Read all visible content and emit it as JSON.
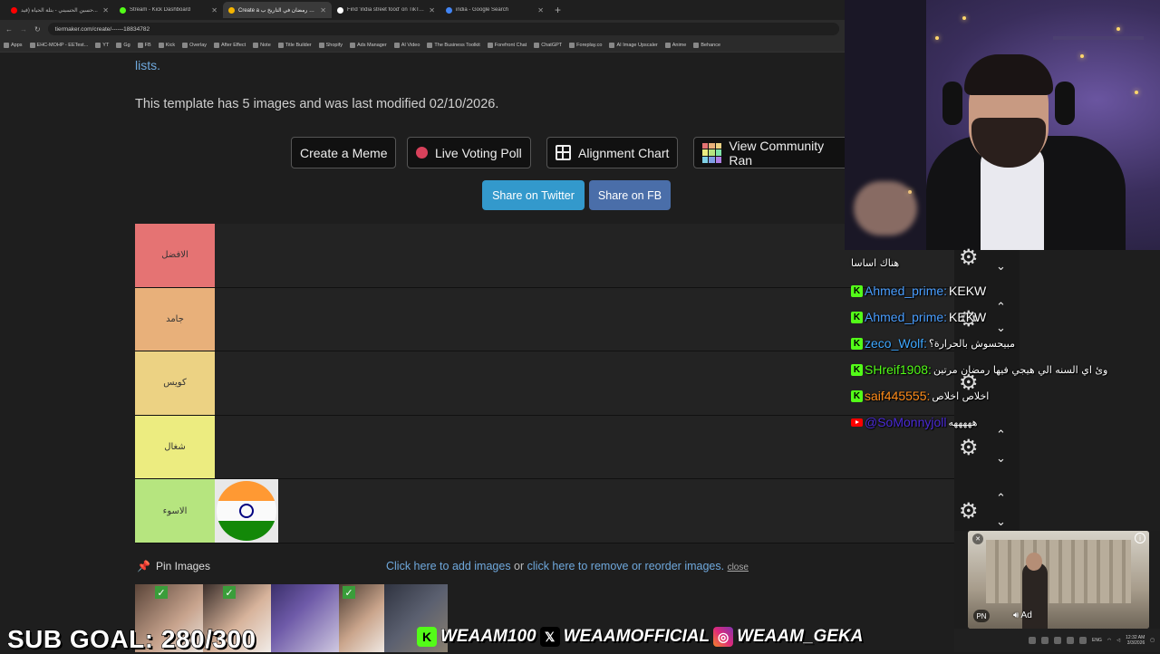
{
  "browser": {
    "tabs": [
      {
        "title": "حسين الحسيني - بتلة الحياة (فيد...",
        "color": "#ff0000",
        "active": false
      },
      {
        "title": "Stream - Kick Dashboard",
        "color": "#53fc18",
        "active": false
      },
      {
        "title": "Create a ماتات رمضان في التاريخ ب...",
        "color": "#f4b400",
        "active": true
      },
      {
        "title": "Find 'india street food' on TikTok...",
        "color": "#ffffff",
        "active": false
      },
      {
        "title": "india - Google Search",
        "color": "#4285f4",
        "active": false
      }
    ],
    "url": "tiermaker.com/create/------18834782",
    "bookmarks": [
      "Apps",
      "EHC-MOHP - EETest...",
      "YT",
      "Gg",
      "FB",
      "Kick",
      "Overlay",
      "After Effect",
      "Note",
      "Title Builder",
      "Shopify",
      "Ads Manager",
      "AI Video",
      "The Business Toolkit",
      "Forefront Chat",
      "ChatGPT",
      "Foreplay.co",
      "AI Image Upscaler",
      "Anime",
      "Behance"
    ]
  },
  "page": {
    "lists_link": "lists.",
    "info_text": "This template has 5 images and was last modified 02/10/2026.",
    "buttons": {
      "create_meme": "Create a Meme",
      "live_poll": "Live Voting Poll",
      "alignment_chart": "Alignment Chart",
      "community_rank": "View Community Ran"
    },
    "share": {
      "twitter": "Share on Twitter",
      "fb": "Share on FB"
    },
    "tiers": [
      {
        "label": "الافضل",
        "color": "#e57373"
      },
      {
        "label": "جامد",
        "color": "#e8b07a"
      },
      {
        "label": "كويس",
        "color": "#ecd283"
      },
      {
        "label": "شغال",
        "color": "#ecec80"
      },
      {
        "label": "الاسوء",
        "color": "#b6e57f"
      }
    ],
    "pin_images": "Pin Images",
    "add_images": "Click here to add images",
    "or": " or ",
    "remove_images": "click here to remove or reorder images.",
    "close": "close"
  },
  "chat": [
    {
      "platform": "none",
      "user": "",
      "user_color": "#ffffff",
      "message": "هناك اساسا"
    },
    {
      "platform": "kick",
      "user": "Ahmed_prime:",
      "user_color": "#4a9eff",
      "message": "KEKW"
    },
    {
      "platform": "kick",
      "user": "Ahmed_prime:",
      "user_color": "#4a9eff",
      "message": "KEKW"
    },
    {
      "platform": "kick",
      "user": "zeco_Wolf:",
      "user_color": "#3fa8ff",
      "message": "مبيحسوش بالحرارة؟"
    },
    {
      "platform": "kick",
      "user": "SHreif1908:",
      "user_color": "#53fc18",
      "message": "وئ اي السنه الي هيجي فيها رمضان مرتين"
    },
    {
      "platform": "kick",
      "user": "saif445555:",
      "user_color": "#ff8c1a",
      "message": "اخلاص اخلاص"
    },
    {
      "platform": "youtube",
      "user": "@SoMonnyjoll",
      "user_color": "#4b2bd6",
      "message": "هههههه"
    }
  ],
  "overlay": {
    "sub_goal": "SUB GOAL: 280/300",
    "kick_handle": "WEAAM100",
    "x_handle": "WEAAMOFFICIAL",
    "ig_handle": "WEAAM_GEKA"
  },
  "ad": {
    "label": "Ad"
  },
  "taskbar": {
    "lang": "ENG",
    "time": "12:32 AM",
    "date": "3/3/2026"
  },
  "colors": {
    "kick_green": "#53fc18",
    "twitter_blue": "#3399cc",
    "fb_blue": "#4a6ea9",
    "link_blue": "#6fa8dc"
  }
}
